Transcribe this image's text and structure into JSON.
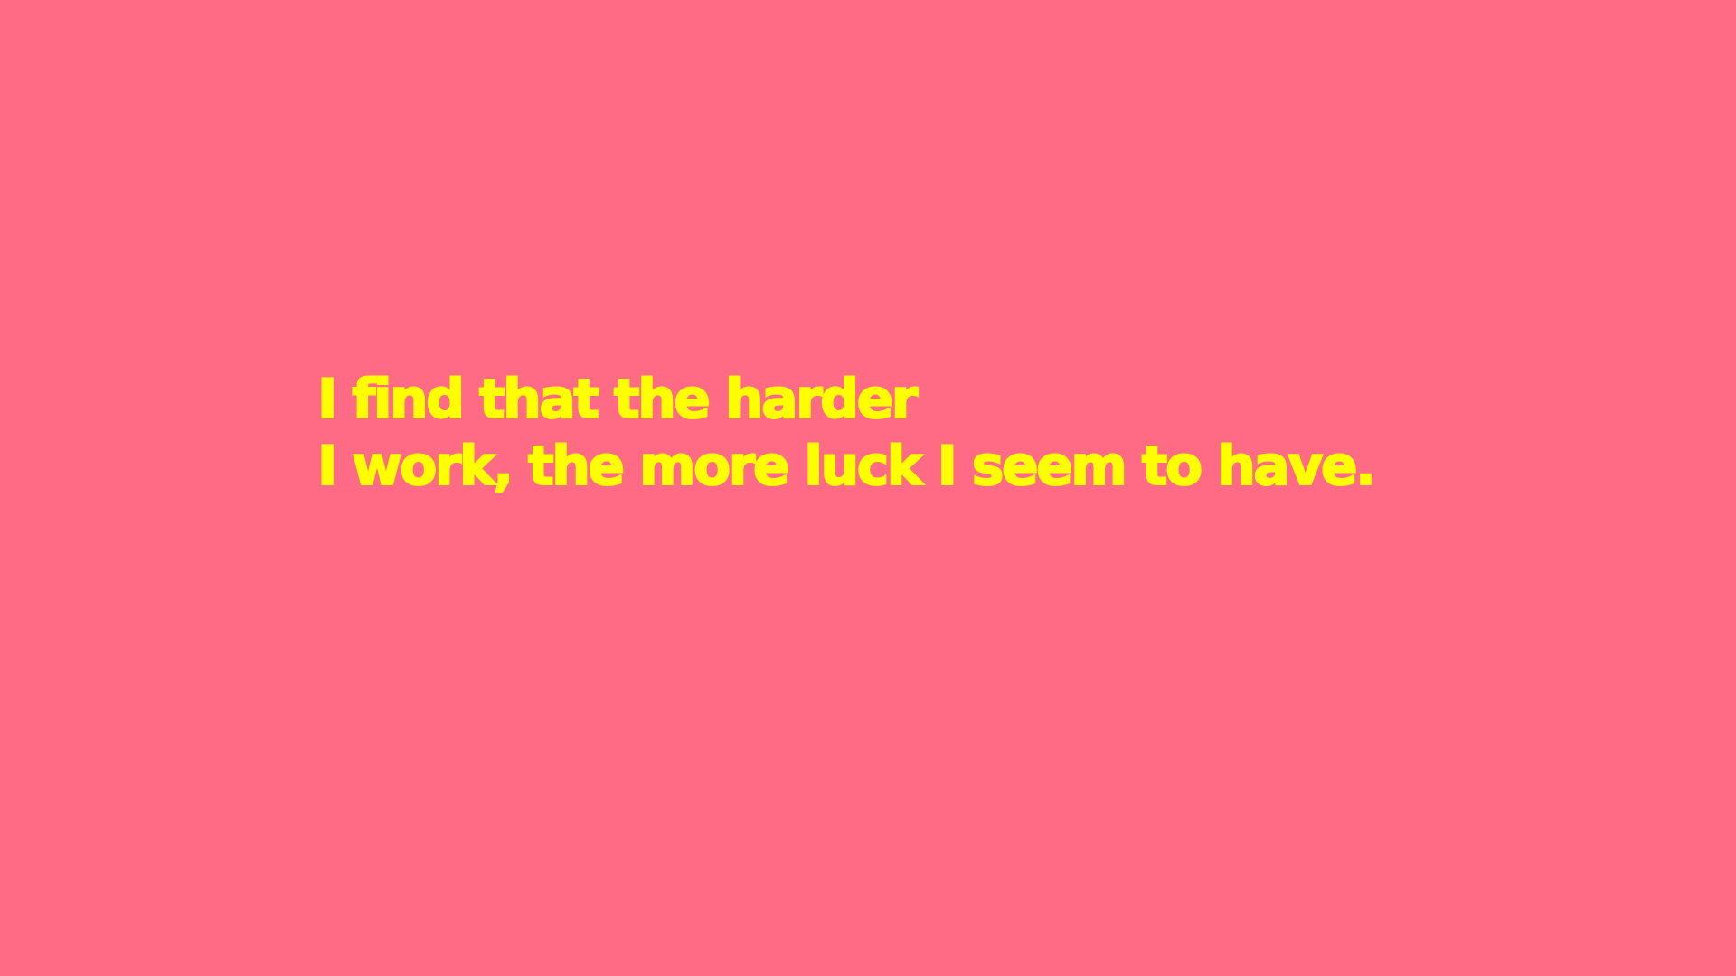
{
  "quote": {
    "lines": [
      "I find that the harder",
      "I work, the more luck I seem to have."
    ]
  },
  "colors": {
    "background": "#ff6b85",
    "text": "#ffff00"
  }
}
